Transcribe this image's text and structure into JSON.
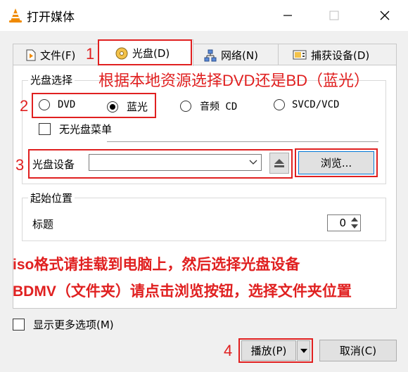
{
  "window": {
    "title": "打开媒体"
  },
  "tabs": [
    {
      "label": "文件(F)",
      "marker": "1"
    },
    {
      "label": "光盘(D)"
    },
    {
      "label": "网络(N)"
    },
    {
      "label": "捕获设备(D)"
    }
  ],
  "disc_selection": {
    "legend": "光盘选择",
    "marker": "2",
    "radios": [
      {
        "label": "DVD",
        "selected": false
      },
      {
        "label": "蓝光",
        "selected": true
      },
      {
        "label": "音频 CD",
        "selected": false
      },
      {
        "label": "SVCD/VCD",
        "selected": false
      }
    ],
    "no_menu_label": "无光盘菜单"
  },
  "device": {
    "marker": "3",
    "label": "光盘设备",
    "value": "",
    "browse_label": "浏览..."
  },
  "start_position": {
    "legend": "起始位置",
    "title_label": "标题",
    "title_value": "0"
  },
  "annotations": {
    "top": "根据本地资源选择DVD还是BD（蓝光）",
    "line1": "iso格式请挂载到电脑上，然后选择光盘设备",
    "line2": "BDMV（文件夹）请点击浏览按钮，选择文件夹位置"
  },
  "footer": {
    "more_options_label": "显示更多选项(M)",
    "marker": "4",
    "play_label": "播放(P)",
    "cancel_label": "取消(C)"
  },
  "colors": {
    "annotation_red": "#e02020",
    "vlc_orange": "#f08a00"
  },
  "icons": [
    "vlc-cone-icon",
    "minimize-icon",
    "maximize-icon",
    "close-icon",
    "file-icon",
    "disc-icon",
    "network-icon",
    "capture-icon",
    "dropdown-arrow-icon",
    "eject-icon",
    "spin-up-icon",
    "spin-down-icon"
  ]
}
